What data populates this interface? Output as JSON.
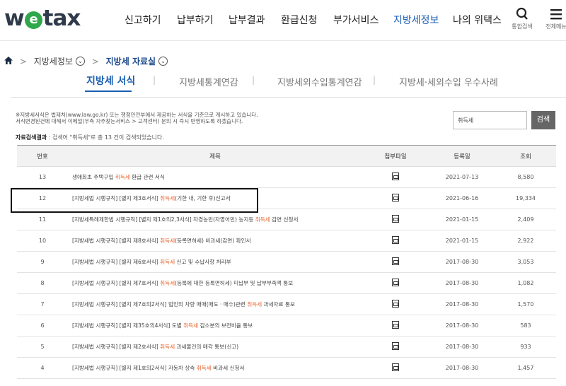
{
  "header": {
    "logo": {
      "pre": "w",
      "ring": "e",
      "post": "tax"
    },
    "nav": [
      {
        "label": "신고하기"
      },
      {
        "label": "납부하기"
      },
      {
        "label": "납부결과"
      },
      {
        "label": "환급신청"
      },
      {
        "label": "부가서비스"
      },
      {
        "label": "지방세정보"
      },
      {
        "label": "나의 위택스"
      }
    ],
    "utilities": [
      {
        "label": "통합검색",
        "icon": "search-icon"
      },
      {
        "label": "전체메뉴",
        "icon": "menu-icon"
      }
    ]
  },
  "breadcrumb": {
    "level1": "지방세정보",
    "level2": "지방세 자료실"
  },
  "subtabs": [
    {
      "label": "지방세 서식"
    },
    {
      "label": "지방세통계연감"
    },
    {
      "label": "지방세외수입통계연감"
    },
    {
      "label": "지방세·세외수입 우수사례"
    }
  ],
  "notice": {
    "line1": "※지방세서식은 법제처(www.law.go.kr) 또는 행정안전부에서 제공하는 서식을 기준으로 게시하고 있습니다.",
    "line2": "서식변경된건에 대해서 이메일(우측 자주찾는서비스 > 고객센터) 문의 시 즉시 반영하도록 하겠습니다."
  },
  "search": {
    "value": "취득세",
    "button": "검색"
  },
  "result": {
    "label": "자료검색결과",
    "text": " : 검색어 \"취득세\"로 총 13 건이 검색되었습니다."
  },
  "table": {
    "headers": {
      "no": "번호",
      "title": "제목",
      "file": "첨부파일",
      "date": "등록일",
      "views": "조회"
    },
    "keyword": "취득세",
    "rows": [
      {
        "no": "13",
        "pre": "생애최초 주택구입 ",
        "post": " 환급 관련 서식",
        "date": "2021-07-13",
        "views": "8,580"
      },
      {
        "no": "12",
        "pre": "[지방세법 시행규칙] [별지 제3호서식] ",
        "post": "(기한 내, 기한 후)신고서",
        "date": "2021-06-16",
        "views": "19,334"
      },
      {
        "no": "11",
        "pre": "[지방세특례제한법 시행규칙] [별지 제1호의2,3서식] 자경농민(자영어민) 농지등 ",
        "post": " 감면 신청서",
        "date": "2021-01-15",
        "views": "2,409"
      },
      {
        "no": "10",
        "pre": "[지방세법 시행규칙] [별지 제8호서식] ",
        "post": "(등록면허세) 비과세(감면) 확인서",
        "date": "2021-01-15",
        "views": "2,922"
      },
      {
        "no": "9",
        "pre": "[지방세법 시행규칙] [별지 제6호서식] ",
        "post": " 신고 및 수납사항 처리부",
        "date": "2017-08-30",
        "views": "3,053"
      },
      {
        "no": "8",
        "pre": "[지방세법 시행규칙] [별지 제7호서식] ",
        "post": "(등록에 대한 등록면허세) 미납부 및 납부부족액 통보",
        "date": "2017-08-30",
        "views": "1,082"
      },
      {
        "no": "7",
        "pre": "[지방세법 시행규칙] [별지 제7호의2서식] 법인의 차량 매매(매도 · 매수)관련 ",
        "post": " 과세자료 통보",
        "date": "2017-08-30",
        "views": "1,570"
      },
      {
        "no": "6",
        "pre": "[지방세법 시행규칙] [별지 제35호의4서식] 도별 ",
        "post": " 감소분의 보전비율 통보",
        "date": "2017-08-30",
        "views": "583"
      },
      {
        "no": "5",
        "pre": "[지방세법 시행규칙] [별지 제2호서식] ",
        "post": " 과세물건의 매각 통보(신고)",
        "date": "2017-08-30",
        "views": "933"
      },
      {
        "no": "4",
        "pre": "[지방세법 시행규칙] [별지 제1호의2서식] 자동차 상속 ",
        "post": " 비과세 신청서",
        "date": "2017-08-30",
        "views": "1,457"
      }
    ]
  }
}
